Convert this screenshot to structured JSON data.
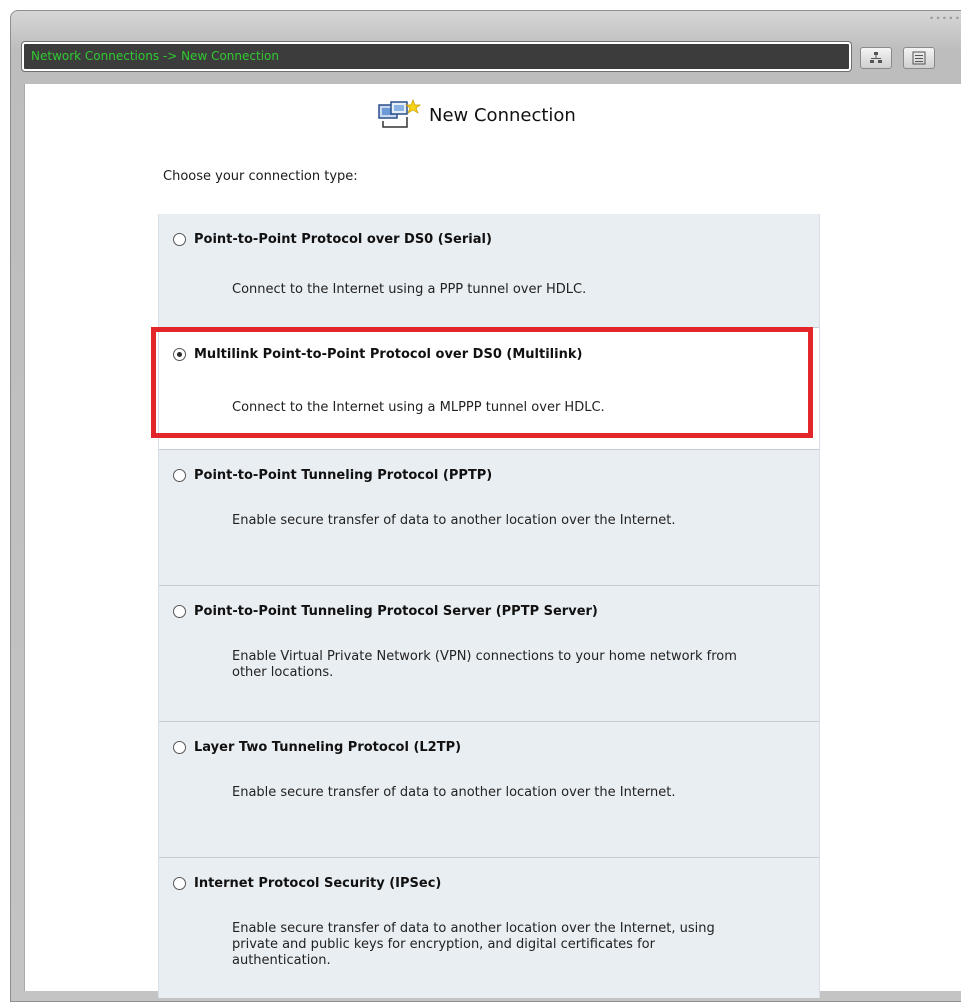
{
  "window": {
    "title": "Network Connections -> New Connection",
    "toolbar_buttons": [
      {
        "icon": "network-map-icon"
      },
      {
        "icon": "list-view-icon"
      }
    ]
  },
  "page": {
    "heading": "New Connection",
    "heading_icon": "new-connection-icon",
    "prompt": "Choose your connection type:"
  },
  "options": [
    {
      "label": "Point-to-Point Protocol over DS0 (Serial)",
      "description": "Connect to the Internet using a PPP tunnel over HDLC.",
      "selected": false
    },
    {
      "label": "Multilink Point-to-Point Protocol over DS0 (Multilink)",
      "description": "Connect to the Internet using a MLPPP tunnel over HDLC.",
      "selected": true
    },
    {
      "label": "Point-to-Point Tunneling Protocol (PPTP)",
      "description": "Enable secure transfer of data to another location over the Internet.",
      "selected": false
    },
    {
      "label": "Point-to-Point Tunneling Protocol Server (PPTP Server)",
      "description": "Enable Virtual Private Network (VPN) connections to your home network from other locations.",
      "selected": false
    },
    {
      "label": "Layer Two Tunneling Protocol (L2TP)",
      "description": "Enable secure transfer of data to another location over the Internet.",
      "selected": false
    },
    {
      "label": "Internet Protocol Security (IPSec)",
      "description": "Enable secure transfer of data to another location over the Internet, using private and public keys for encryption, and digital certificates for authentication.",
      "selected": false
    }
  ],
  "colors": {
    "title_text": "#31c931",
    "highlight": "#e3262a",
    "option_bg": "#e9eef3"
  }
}
